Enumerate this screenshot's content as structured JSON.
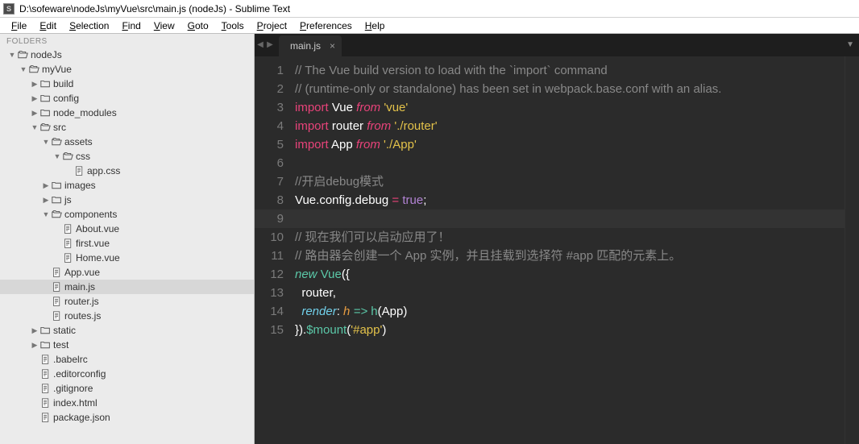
{
  "window": {
    "title": "D:\\sofeware\\nodeJs\\myVue\\src\\main.js (nodeJs) - Sublime Text"
  },
  "menu": {
    "items": [
      "File",
      "Edit",
      "Selection",
      "Find",
      "View",
      "Goto",
      "Tools",
      "Project",
      "Preferences",
      "Help"
    ]
  },
  "sidebar": {
    "header": "FOLDERS",
    "tree": [
      {
        "label": "nodeJs",
        "type": "folder-open",
        "depth": 0,
        "disclosure": "▼"
      },
      {
        "label": "myVue",
        "type": "folder-open",
        "depth": 1,
        "disclosure": "▼"
      },
      {
        "label": "build",
        "type": "folder",
        "depth": 2,
        "disclosure": "▶"
      },
      {
        "label": "config",
        "type": "folder",
        "depth": 2,
        "disclosure": "▶"
      },
      {
        "label": "node_modules",
        "type": "folder",
        "depth": 2,
        "disclosure": "▶"
      },
      {
        "label": "src",
        "type": "folder-open",
        "depth": 2,
        "disclosure": "▼"
      },
      {
        "label": "assets",
        "type": "folder-open",
        "depth": 3,
        "disclosure": "▼"
      },
      {
        "label": "css",
        "type": "folder-open",
        "depth": 4,
        "disclosure": "▼"
      },
      {
        "label": "app.css",
        "type": "file",
        "depth": 5,
        "disclosure": ""
      },
      {
        "label": "images",
        "type": "folder",
        "depth": 3,
        "disclosure": "▶"
      },
      {
        "label": "js",
        "type": "folder",
        "depth": 3,
        "disclosure": "▶"
      },
      {
        "label": "components",
        "type": "folder-open",
        "depth": 3,
        "disclosure": "▼"
      },
      {
        "label": "About.vue",
        "type": "file",
        "depth": 4,
        "disclosure": ""
      },
      {
        "label": "first.vue",
        "type": "file",
        "depth": 4,
        "disclosure": ""
      },
      {
        "label": "Home.vue",
        "type": "file",
        "depth": 4,
        "disclosure": ""
      },
      {
        "label": "App.vue",
        "type": "file",
        "depth": 3,
        "disclosure": ""
      },
      {
        "label": "main.js",
        "type": "file",
        "depth": 3,
        "disclosure": "",
        "selected": true
      },
      {
        "label": "router.js",
        "type": "file",
        "depth": 3,
        "disclosure": ""
      },
      {
        "label": "routes.js",
        "type": "file",
        "depth": 3,
        "disclosure": ""
      },
      {
        "label": "static",
        "type": "folder",
        "depth": 2,
        "disclosure": "▶"
      },
      {
        "label": "test",
        "type": "folder",
        "depth": 2,
        "disclosure": "▶"
      },
      {
        "label": ".babelrc",
        "type": "file",
        "depth": 2,
        "disclosure": ""
      },
      {
        "label": ".editorconfig",
        "type": "file",
        "depth": 2,
        "disclosure": ""
      },
      {
        "label": ".gitignore",
        "type": "file",
        "depth": 2,
        "disclosure": ""
      },
      {
        "label": "index.html",
        "type": "file",
        "depth": 2,
        "disclosure": ""
      },
      {
        "label": "package.json",
        "type": "file",
        "depth": 2,
        "disclosure": ""
      }
    ]
  },
  "tabs": {
    "active": {
      "label": "main.js",
      "close": "×"
    }
  },
  "code": {
    "lines": [
      {
        "n": 1,
        "tokens": [
          [
            "comment",
            "// The Vue build version to load with the `import` command"
          ]
        ]
      },
      {
        "n": 2,
        "tokens": [
          [
            "comment",
            "// (runtime-only or standalone) has been set in webpack.base.conf with an alias."
          ]
        ]
      },
      {
        "n": 3,
        "tokens": [
          [
            "keyword",
            "import"
          ],
          [
            "ident",
            " Vue "
          ],
          [
            "from",
            "from"
          ],
          [
            "string",
            " 'vue'"
          ]
        ]
      },
      {
        "n": 4,
        "tokens": [
          [
            "keyword",
            "import"
          ],
          [
            "ident",
            " router "
          ],
          [
            "from",
            "from"
          ],
          [
            "string",
            " './router'"
          ]
        ]
      },
      {
        "n": 5,
        "tokens": [
          [
            "keyword",
            "import"
          ],
          [
            "ident",
            " App "
          ],
          [
            "from",
            "from"
          ],
          [
            "string",
            " './App'"
          ]
        ]
      },
      {
        "n": 6,
        "tokens": []
      },
      {
        "n": 7,
        "tokens": [
          [
            "comment",
            "//开启debug模式"
          ]
        ]
      },
      {
        "n": 8,
        "tokens": [
          [
            "attr",
            "Vue"
          ],
          [
            "punc",
            "."
          ],
          [
            "attr",
            "config"
          ],
          [
            "punc",
            "."
          ],
          [
            "attr",
            "debug "
          ],
          [
            "op",
            "="
          ],
          [
            "const",
            " true"
          ],
          [
            "punc",
            ";"
          ]
        ]
      },
      {
        "n": 9,
        "tokens": [],
        "highlight": true
      },
      {
        "n": 10,
        "tokens": [
          [
            "comment",
            "// 现在我们可以启动应用了！"
          ]
        ]
      },
      {
        "n": 11,
        "tokens": [
          [
            "comment",
            "// 路由器会创建一个 App 实例，并且挂载到选择符 #app 匹配的元素上。"
          ]
        ]
      },
      {
        "n": 12,
        "tokens": [
          [
            "new",
            "new"
          ],
          [
            "func",
            " Vue"
          ],
          [
            "punc",
            "({"
          ]
        ]
      },
      {
        "n": 13,
        "tokens": [
          [
            "ident",
            "  router"
          ],
          [
            "punc",
            ","
          ]
        ]
      },
      {
        "n": 14,
        "tokens": [
          [
            "ident",
            "  "
          ],
          [
            "render",
            "render"
          ],
          [
            "punc",
            ": "
          ],
          [
            "param",
            "h"
          ],
          [
            "ident",
            " "
          ],
          [
            "arrow",
            "=>"
          ],
          [
            "func",
            " h"
          ],
          [
            "punc",
            "("
          ],
          [
            "ident",
            "App"
          ],
          [
            "punc",
            ")"
          ]
        ]
      },
      {
        "n": 15,
        "tokens": [
          [
            "punc",
            "})."
          ],
          [
            "mount",
            "$mount"
          ],
          [
            "punc",
            "("
          ],
          [
            "string",
            "'#app'"
          ],
          [
            "punc",
            ")"
          ]
        ]
      }
    ]
  }
}
